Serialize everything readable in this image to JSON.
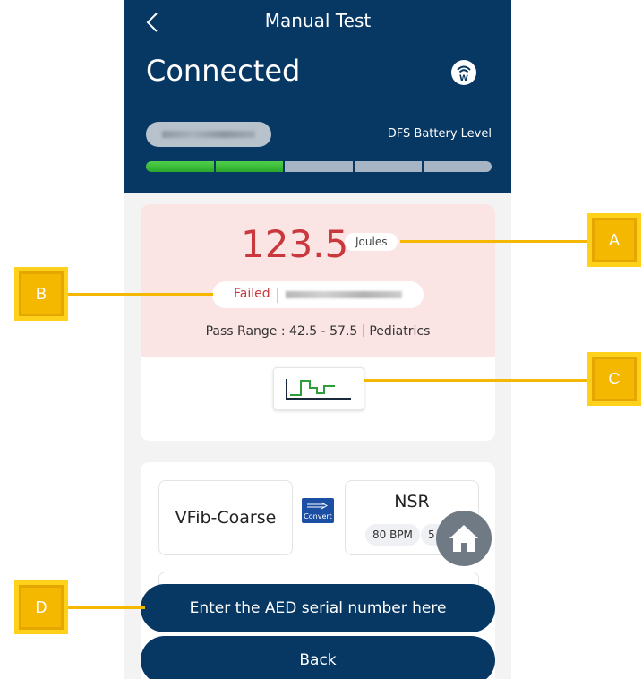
{
  "header": {
    "title": "Manual Test",
    "status": "Connected",
    "battery_label": "DFS Battery Level",
    "battery_segments_total": 5,
    "battery_segments_filled": 2,
    "wifi_icon": "wifi-w-icon",
    "back_icon": "chevron-left-icon"
  },
  "result": {
    "energy_value": "123.5",
    "energy_unit": "Joules",
    "status_text": "Failed",
    "pass_range": "Pass Range : 42.5 - 57.5",
    "category": "Pediatrics",
    "waveform_icon": "waveform-icon"
  },
  "rhythm": {
    "from_label": "VFib-Coarse",
    "convert_label": "Convert",
    "to_label": "NSR",
    "bpm": "80 BPM",
    "second_chip": "5 r"
  },
  "buttons": {
    "serial": "Enter the AED serial number here",
    "back": "Back",
    "home_icon": "home-icon"
  },
  "callouts": {
    "a": "A",
    "b": "B",
    "c": "C",
    "d": "D"
  },
  "colors": {
    "header_bg": "#073763",
    "fail_red": "#c8383c",
    "fail_bg": "#fbe4e4",
    "battery_green": "#3cc23a",
    "callout_yellow": "#f5b800"
  }
}
